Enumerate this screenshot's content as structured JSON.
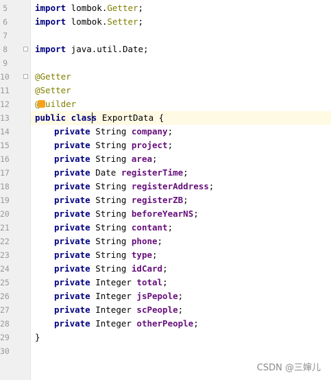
{
  "editor": {
    "lines": [
      {
        "num": "5",
        "parts": [
          {
            "t": "kw",
            "v": "import"
          },
          {
            "t": "plain",
            "v": " lombok."
          },
          {
            "t": "ann",
            "v": "Getter"
          },
          {
            "t": "plain",
            "v": ";"
          }
        ]
      },
      {
        "num": "6",
        "parts": [
          {
            "t": "kw",
            "v": "import"
          },
          {
            "t": "plain",
            "v": " lombok."
          },
          {
            "t": "ann",
            "v": "Setter"
          },
          {
            "t": "plain",
            "v": ";"
          }
        ]
      },
      {
        "num": "7",
        "parts": []
      },
      {
        "num": "8",
        "parts": [
          {
            "t": "kw",
            "v": "import"
          },
          {
            "t": "plain",
            "v": " java.util.Date;"
          }
        ],
        "fold": true
      },
      {
        "num": "9",
        "parts": []
      },
      {
        "num": "10",
        "parts": [
          {
            "t": "ann",
            "v": "@Getter"
          }
        ],
        "fold": true
      },
      {
        "num": "11",
        "parts": [
          {
            "t": "ann",
            "v": "@Setter"
          }
        ]
      },
      {
        "num": "12",
        "parts": [
          {
            "t": "ann",
            "v": "@Builder"
          }
        ],
        "bulb": true
      },
      {
        "num": "13",
        "parts": [
          {
            "t": "kw",
            "v": "public class"
          },
          {
            "t": "plain",
            "v": " ExportData {"
          }
        ],
        "current": true
      },
      {
        "num": "14",
        "indent": true,
        "parts": [
          {
            "t": "kw",
            "v": "private"
          },
          {
            "t": "plain",
            "v": " String "
          },
          {
            "t": "field",
            "v": "company"
          },
          {
            "t": "plain",
            "v": ";"
          }
        ]
      },
      {
        "num": "15",
        "indent": true,
        "parts": [
          {
            "t": "kw",
            "v": "private"
          },
          {
            "t": "plain",
            "v": " String "
          },
          {
            "t": "field",
            "v": "project"
          },
          {
            "t": "plain",
            "v": ";"
          }
        ]
      },
      {
        "num": "16",
        "indent": true,
        "parts": [
          {
            "t": "kw",
            "v": "private"
          },
          {
            "t": "plain",
            "v": " String "
          },
          {
            "t": "field",
            "v": "area"
          },
          {
            "t": "plain",
            "v": ";"
          }
        ]
      },
      {
        "num": "17",
        "indent": true,
        "parts": [
          {
            "t": "kw",
            "v": "private"
          },
          {
            "t": "plain",
            "v": " Date "
          },
          {
            "t": "field",
            "v": "registerTime"
          },
          {
            "t": "plain",
            "v": ";"
          }
        ]
      },
      {
        "num": "18",
        "indent": true,
        "parts": [
          {
            "t": "kw",
            "v": "private"
          },
          {
            "t": "plain",
            "v": " String "
          },
          {
            "t": "field",
            "v": "registerAddress"
          },
          {
            "t": "plain",
            "v": ";"
          }
        ]
      },
      {
        "num": "19",
        "indent": true,
        "parts": [
          {
            "t": "kw",
            "v": "private"
          },
          {
            "t": "plain",
            "v": " String "
          },
          {
            "t": "field",
            "v": "registerZB"
          },
          {
            "t": "plain",
            "v": ";"
          }
        ]
      },
      {
        "num": "20",
        "indent": true,
        "parts": [
          {
            "t": "kw",
            "v": "private"
          },
          {
            "t": "plain",
            "v": " String "
          },
          {
            "t": "field",
            "v": "beforeYearNS"
          },
          {
            "t": "plain",
            "v": ";"
          }
        ]
      },
      {
        "num": "21",
        "indent": true,
        "parts": [
          {
            "t": "kw",
            "v": "private"
          },
          {
            "t": "plain",
            "v": " String "
          },
          {
            "t": "field",
            "v": "contant"
          },
          {
            "t": "plain",
            "v": ";"
          }
        ]
      },
      {
        "num": "22",
        "indent": true,
        "parts": [
          {
            "t": "kw",
            "v": "private"
          },
          {
            "t": "plain",
            "v": " String "
          },
          {
            "t": "field",
            "v": "phone"
          },
          {
            "t": "plain",
            "v": ";"
          }
        ]
      },
      {
        "num": "23",
        "indent": true,
        "parts": [
          {
            "t": "kw",
            "v": "private"
          },
          {
            "t": "plain",
            "v": " String "
          },
          {
            "t": "field",
            "v": "type"
          },
          {
            "t": "plain",
            "v": ";"
          }
        ]
      },
      {
        "num": "24",
        "indent": true,
        "parts": [
          {
            "t": "kw",
            "v": "private"
          },
          {
            "t": "plain",
            "v": " String "
          },
          {
            "t": "field",
            "v": "idCard"
          },
          {
            "t": "plain",
            "v": ";"
          }
        ]
      },
      {
        "num": "25",
        "indent": true,
        "parts": [
          {
            "t": "kw",
            "v": "private"
          },
          {
            "t": "plain",
            "v": " Integer "
          },
          {
            "t": "field",
            "v": "total"
          },
          {
            "t": "plain",
            "v": ";"
          }
        ]
      },
      {
        "num": "26",
        "indent": true,
        "parts": [
          {
            "t": "kw",
            "v": "private"
          },
          {
            "t": "plain",
            "v": " Integer "
          },
          {
            "t": "field",
            "v": "jsPepole"
          },
          {
            "t": "plain",
            "v": ";"
          }
        ]
      },
      {
        "num": "27",
        "indent": true,
        "parts": [
          {
            "t": "kw",
            "v": "private"
          },
          {
            "t": "plain",
            "v": " Integer "
          },
          {
            "t": "field",
            "v": "scPeople"
          },
          {
            "t": "plain",
            "v": ";"
          }
        ]
      },
      {
        "num": "28",
        "indent": true,
        "parts": [
          {
            "t": "kw",
            "v": "private"
          },
          {
            "t": "plain",
            "v": " Integer "
          },
          {
            "t": "field",
            "v": "otherPeople"
          },
          {
            "t": "plain",
            "v": ";"
          }
        ]
      },
      {
        "num": "29",
        "parts": [
          {
            "t": "plain",
            "v": "}"
          }
        ]
      },
      {
        "num": "30",
        "parts": []
      }
    ]
  },
  "watermark": "CSDN @三婶儿",
  "colors": {
    "keyword": "#000080",
    "annotation": "#808000",
    "field": "#660e7a",
    "current_line": "#fffae3",
    "gutter": "#f0f0f0"
  }
}
